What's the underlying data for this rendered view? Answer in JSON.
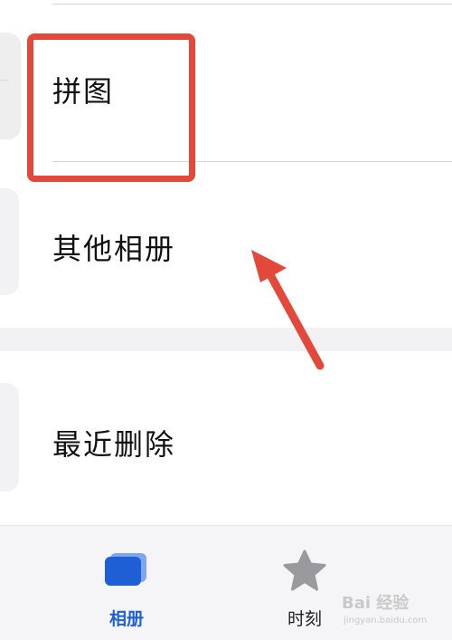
{
  "rows": [
    {
      "label": "拼图"
    },
    {
      "label": "其他相册"
    },
    {
      "label": "最近删除"
    }
  ],
  "tabbar": {
    "albums_label": "相册",
    "moments_label": "时刻"
  },
  "watermark": {
    "main": "Bai 经验",
    "sub": "jingyan.baidu.com"
  },
  "colors": {
    "accent": "#1f5fd6",
    "annotation": "#e2493b"
  }
}
